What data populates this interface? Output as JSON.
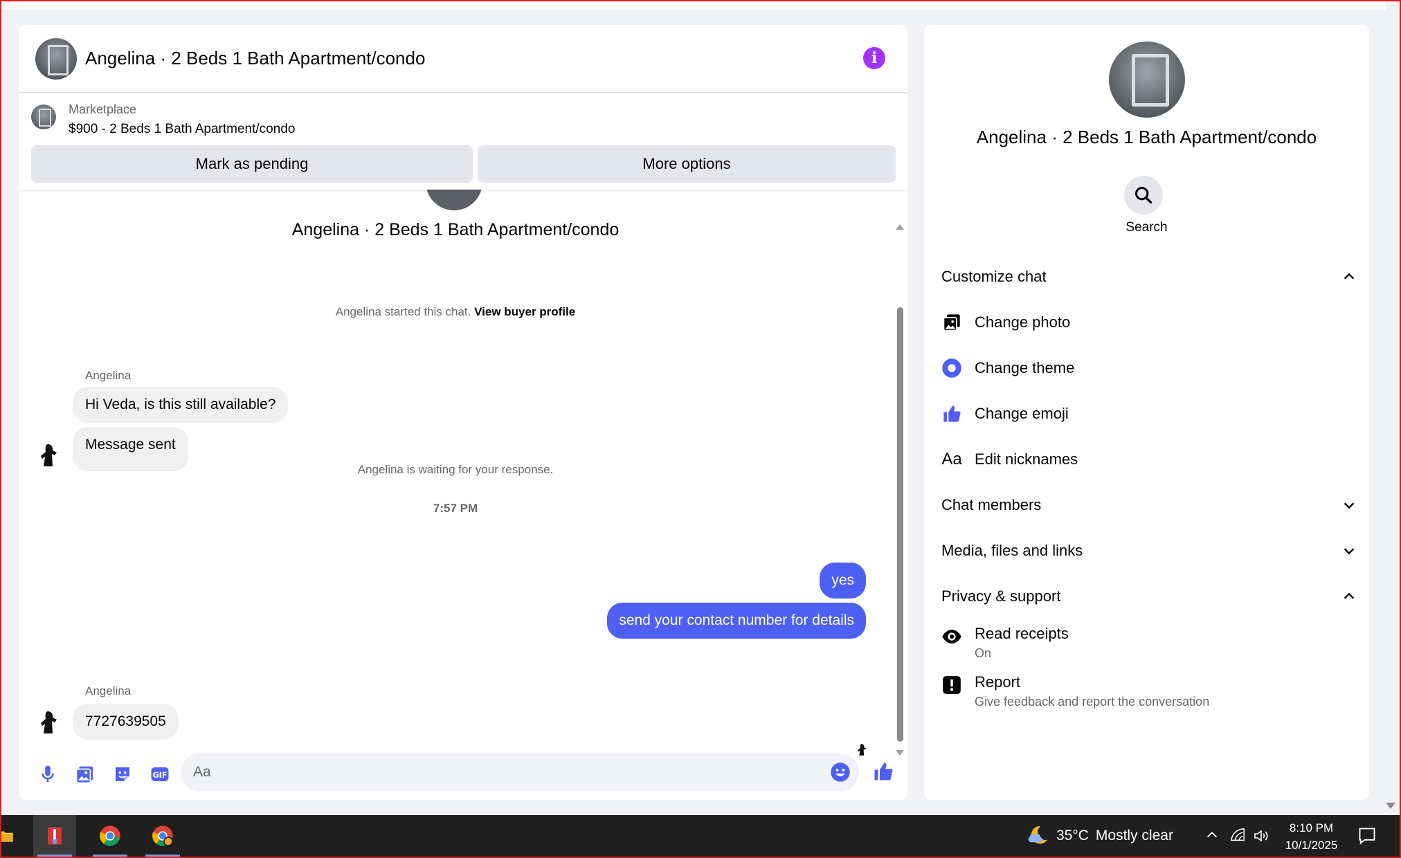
{
  "header": {
    "title": "Angelina · 2 Beds 1 Bath Apartment/condo"
  },
  "marketplace": {
    "label": "Marketplace",
    "listing": "$900 - 2 Beds 1 Bath Apartment/condo",
    "mark_pending_label": "Mark as pending",
    "more_options_label": "More options"
  },
  "thread": {
    "title": "Angelina · 2 Beds 1 Bath Apartment/condo",
    "started_text": "Angelina started this chat.",
    "view_profile_label": "View buyer profile",
    "waiting_text": "Angelina is waiting for your response.",
    "timestamp": "7:57 PM",
    "messages": [
      {
        "sender": "Angelina",
        "text": "Hi Veda, is this still available?"
      },
      {
        "text": "Message sent"
      },
      {
        "text": "yes"
      },
      {
        "text": "send your contact number for details"
      },
      {
        "sender": "Angelina",
        "text": "7727639505"
      }
    ]
  },
  "composer": {
    "placeholder": "Aa"
  },
  "info_panel": {
    "name": "Angelina · 2 Beds 1 Bath Apartment/condo",
    "search_label": "Search",
    "sections": {
      "customize": "Customize chat",
      "members": "Chat members",
      "media": "Media, files and links",
      "privacy": "Privacy & support"
    },
    "customize_items": [
      "Change photo",
      "Change theme",
      "Change emoji",
      "Edit nicknames"
    ],
    "read_receipts": {
      "label": "Read receipts",
      "value": "On"
    },
    "report": {
      "label": "Report",
      "description": "Give feedback and report the conversation"
    }
  },
  "taskbar": {
    "temperature": "35°C",
    "weather": "Mostly clear",
    "time": "8:10 PM",
    "date": "10/1/2025"
  },
  "colors": {
    "accent": "#4e5ff4",
    "info_icon": "#a033ff",
    "composer_icons": "#4e5ff4"
  }
}
